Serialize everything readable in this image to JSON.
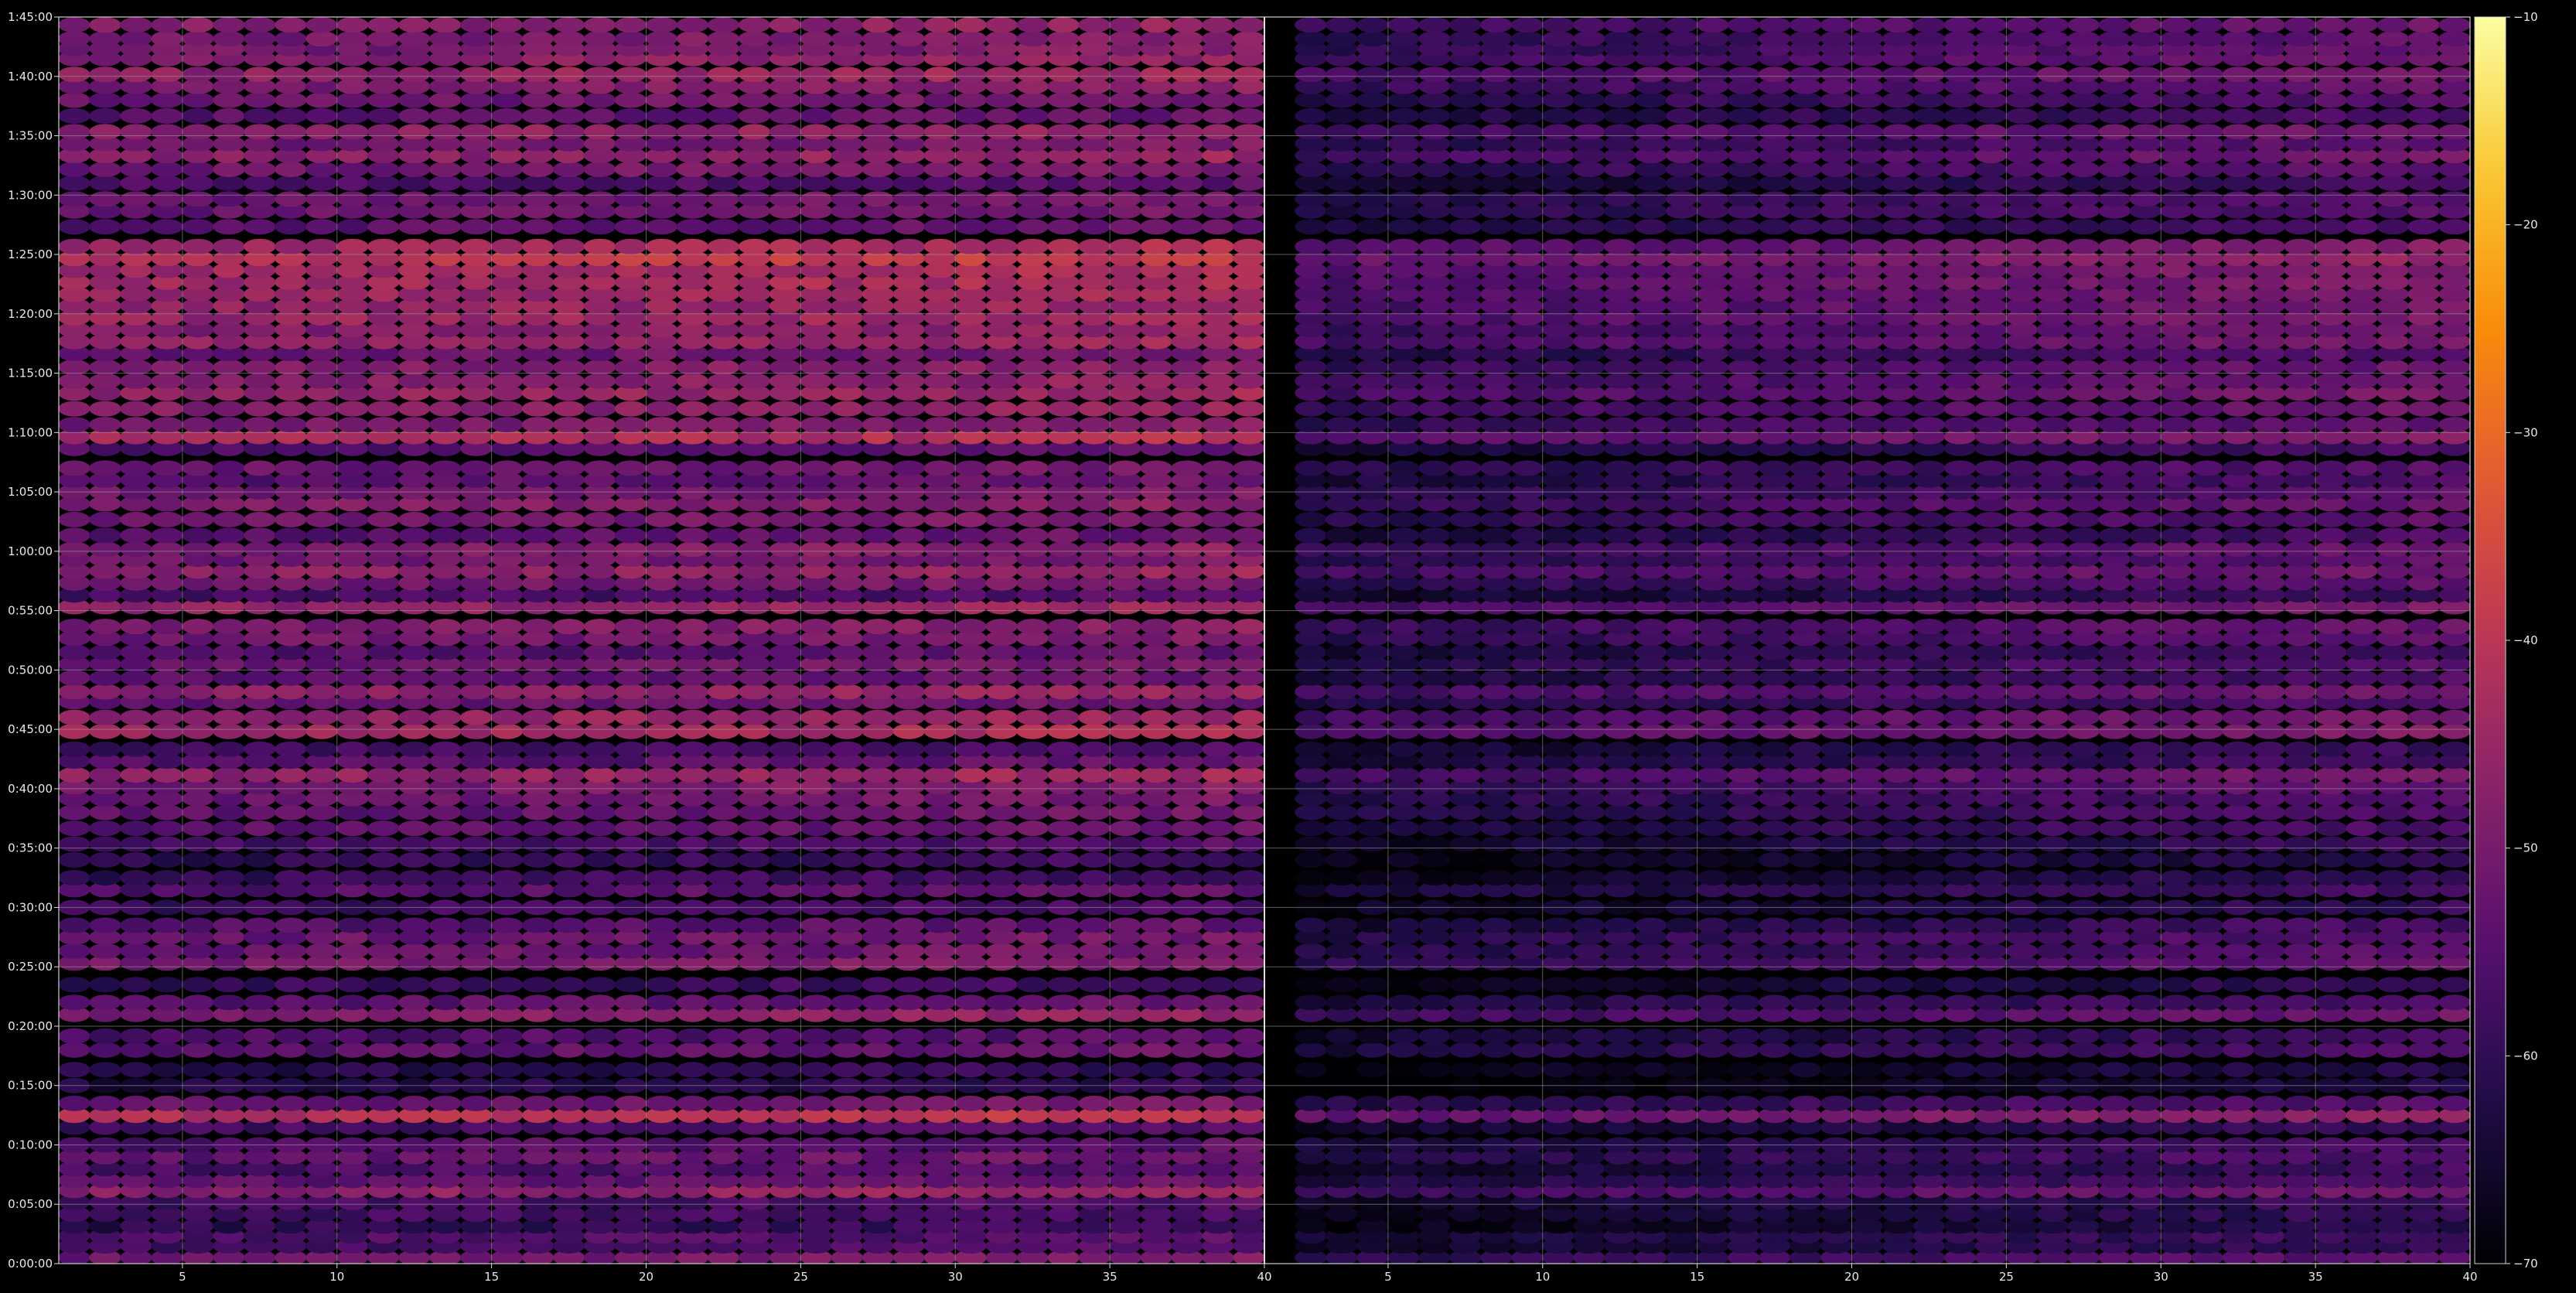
{
  "chart_data": {
    "type": "heatmap",
    "title": "",
    "xlabel": "",
    "ylabel": "",
    "background": "#000000",
    "grid": true,
    "grid_color": "#9a9a9a",
    "colormap": "inferno",
    "colorbar": {
      "position": "right",
      "range": [
        -70,
        -10
      ],
      "ticks": [
        -10,
        -20,
        -30,
        -40,
        -50,
        -60,
        -70
      ]
    },
    "y_axis": {
      "range_seconds": [
        0,
        6300
      ],
      "tick_labels": [
        "0:00:00",
        "0:05:00",
        "0:10:00",
        "0:15:00",
        "0:20:00",
        "0:25:00",
        "0:30:00",
        "0:35:00",
        "0:40:00",
        "0:45:00",
        "0:50:00",
        "0:55:00",
        "1:00:00",
        "1:05:00",
        "1:10:00",
        "1:15:00",
        "1:20:00",
        "1:25:00",
        "1:30:00",
        "1:35:00",
        "1:40:00",
        "1:45:00"
      ]
    },
    "panels": [
      {
        "name": "left",
        "xlim": [
          1,
          40
        ],
        "x_ticks": [
          5,
          10,
          15,
          20,
          25,
          30,
          35,
          40
        ],
        "bins": [
          1,
          39
        ],
        "intensity_scale": 1.0
      },
      {
        "name": "right",
        "xlim": [
          1,
          40
        ],
        "x_ticks": [
          5,
          10,
          15,
          20,
          25,
          30,
          35,
          40
        ],
        "bins": [
          2,
          39
        ],
        "intensity_scale": 0.78
      }
    ],
    "rows": [
      {
        "t": "0:00:30",
        "v": -49
      },
      {
        "t": "0:01:30",
        "v": -55
      },
      {
        "t": "0:02:20",
        "v": -54
      },
      {
        "t": "0:03:10",
        "v": -58
      },
      {
        "t": "0:04:10",
        "v": -56
      },
      {
        "t": "0:05:10",
        "v": -55
      },
      {
        "t": "0:06:10",
        "v": -45
      },
      {
        "t": "0:07:00",
        "v": -52
      },
      {
        "t": "0:08:00",
        "v": -54
      },
      {
        "t": "0:09:00",
        "v": -51
      },
      {
        "t": "0:10:00",
        "v": -53
      },
      {
        "t": "0:11:30",
        "v": -55
      },
      {
        "t": "0:12:30",
        "v": -39
      },
      {
        "t": "0:13:30",
        "v": -50
      },
      {
        "t": "0:15:00",
        "v": -60
      },
      {
        "t": "0:16:20",
        "v": -59
      },
      {
        "t": "0:18:00",
        "v": -52
      },
      {
        "t": "0:19:10",
        "v": -54
      },
      {
        "t": "0:21:00",
        "v": -46
      },
      {
        "t": "0:22:00",
        "v": -52
      },
      {
        "t": "0:23:30",
        "v": -57
      },
      {
        "t": "0:25:20",
        "v": -48
      },
      {
        "t": "0:26:20",
        "v": -50
      },
      {
        "t": "0:27:30",
        "v": -50
      },
      {
        "t": "0:28:30",
        "v": -53
      },
      {
        "t": "0:30:00",
        "v": -56
      },
      {
        "t": "0:31:30",
        "v": -53
      },
      {
        "t": "0:32:30",
        "v": -57
      },
      {
        "t": "0:34:00",
        "v": -58
      },
      {
        "t": "0:35:20",
        "v": -55
      },
      {
        "t": "0:36:40",
        "v": -52
      },
      {
        "t": "0:38:00",
        "v": -51
      },
      {
        "t": "0:39:10",
        "v": -50
      },
      {
        "t": "0:40:10",
        "v": -48
      },
      {
        "t": "0:41:10",
        "v": -44
      },
      {
        "t": "0:42:20",
        "v": -53
      },
      {
        "t": "0:43:20",
        "v": -55
      },
      {
        "t": "0:44:50",
        "v": -42
      },
      {
        "t": "0:46:00",
        "v": -44
      },
      {
        "t": "0:47:20",
        "v": -51
      },
      {
        "t": "0:48:10",
        "v": -45
      },
      {
        "t": "0:49:20",
        "v": -52
      },
      {
        "t": "0:50:30",
        "v": -50
      },
      {
        "t": "0:51:30",
        "v": -53
      },
      {
        "t": "0:52:40",
        "v": -49
      },
      {
        "t": "0:53:40",
        "v": -47
      },
      {
        "t": "0:55:20",
        "v": -44
      },
      {
        "t": "0:56:20",
        "v": -55
      },
      {
        "t": "0:57:20",
        "v": -49
      },
      {
        "t": "0:58:20",
        "v": -45
      },
      {
        "t": "0:59:20",
        "v": -49
      },
      {
        "t": "1:00:10",
        "v": -47
      },
      {
        "t": "1:01:20",
        "v": -52
      },
      {
        "t": "1:02:40",
        "v": -49
      },
      {
        "t": "1:04:00",
        "v": -47
      },
      {
        "t": "1:05:00",
        "v": -49
      },
      {
        "t": "1:06:00",
        "v": -52
      },
      {
        "t": "1:07:00",
        "v": -50
      },
      {
        "t": "1:08:40",
        "v": -53
      },
      {
        "t": "1:09:40",
        "v": -41
      },
      {
        "t": "1:10:40",
        "v": -48
      },
      {
        "t": "1:12:00",
        "v": -46
      },
      {
        "t": "1:13:20",
        "v": -44
      },
      {
        "t": "1:14:20",
        "v": -46
      },
      {
        "t": "1:15:30",
        "v": -47
      },
      {
        "t": "1:16:40",
        "v": -50
      },
      {
        "t": "1:17:40",
        "v": -44
      },
      {
        "t": "1:18:40",
        "v": -46
      },
      {
        "t": "1:19:40",
        "v": -43
      },
      {
        "t": "1:20:40",
        "v": -44
      },
      {
        "t": "1:21:40",
        "v": -43
      },
      {
        "t": "1:22:40",
        "v": -42
      },
      {
        "t": "1:23:40",
        "v": -42
      },
      {
        "t": "1:24:40",
        "v": -38
      },
      {
        "t": "1:25:40",
        "v": -42
      },
      {
        "t": "1:27:20",
        "v": -52
      },
      {
        "t": "1:28:40",
        "v": -50
      },
      {
        "t": "1:29:40",
        "v": -50
      },
      {
        "t": "1:31:00",
        "v": -54
      },
      {
        "t": "1:32:10",
        "v": -49
      },
      {
        "t": "1:33:20",
        "v": -45
      },
      {
        "t": "1:34:20",
        "v": -49
      },
      {
        "t": "1:35:20",
        "v": -45
      },
      {
        "t": "1:36:40",
        "v": -52
      },
      {
        "t": "1:38:00",
        "v": -50
      },
      {
        "t": "1:39:10",
        "v": -47
      },
      {
        "t": "1:40:10",
        "v": -44
      },
      {
        "t": "1:41:30",
        "v": -46
      },
      {
        "t": "1:42:20",
        "v": -48
      },
      {
        "t": "1:43:10",
        "v": -48
      },
      {
        "t": "1:44:20",
        "v": -46
      }
    ]
  }
}
